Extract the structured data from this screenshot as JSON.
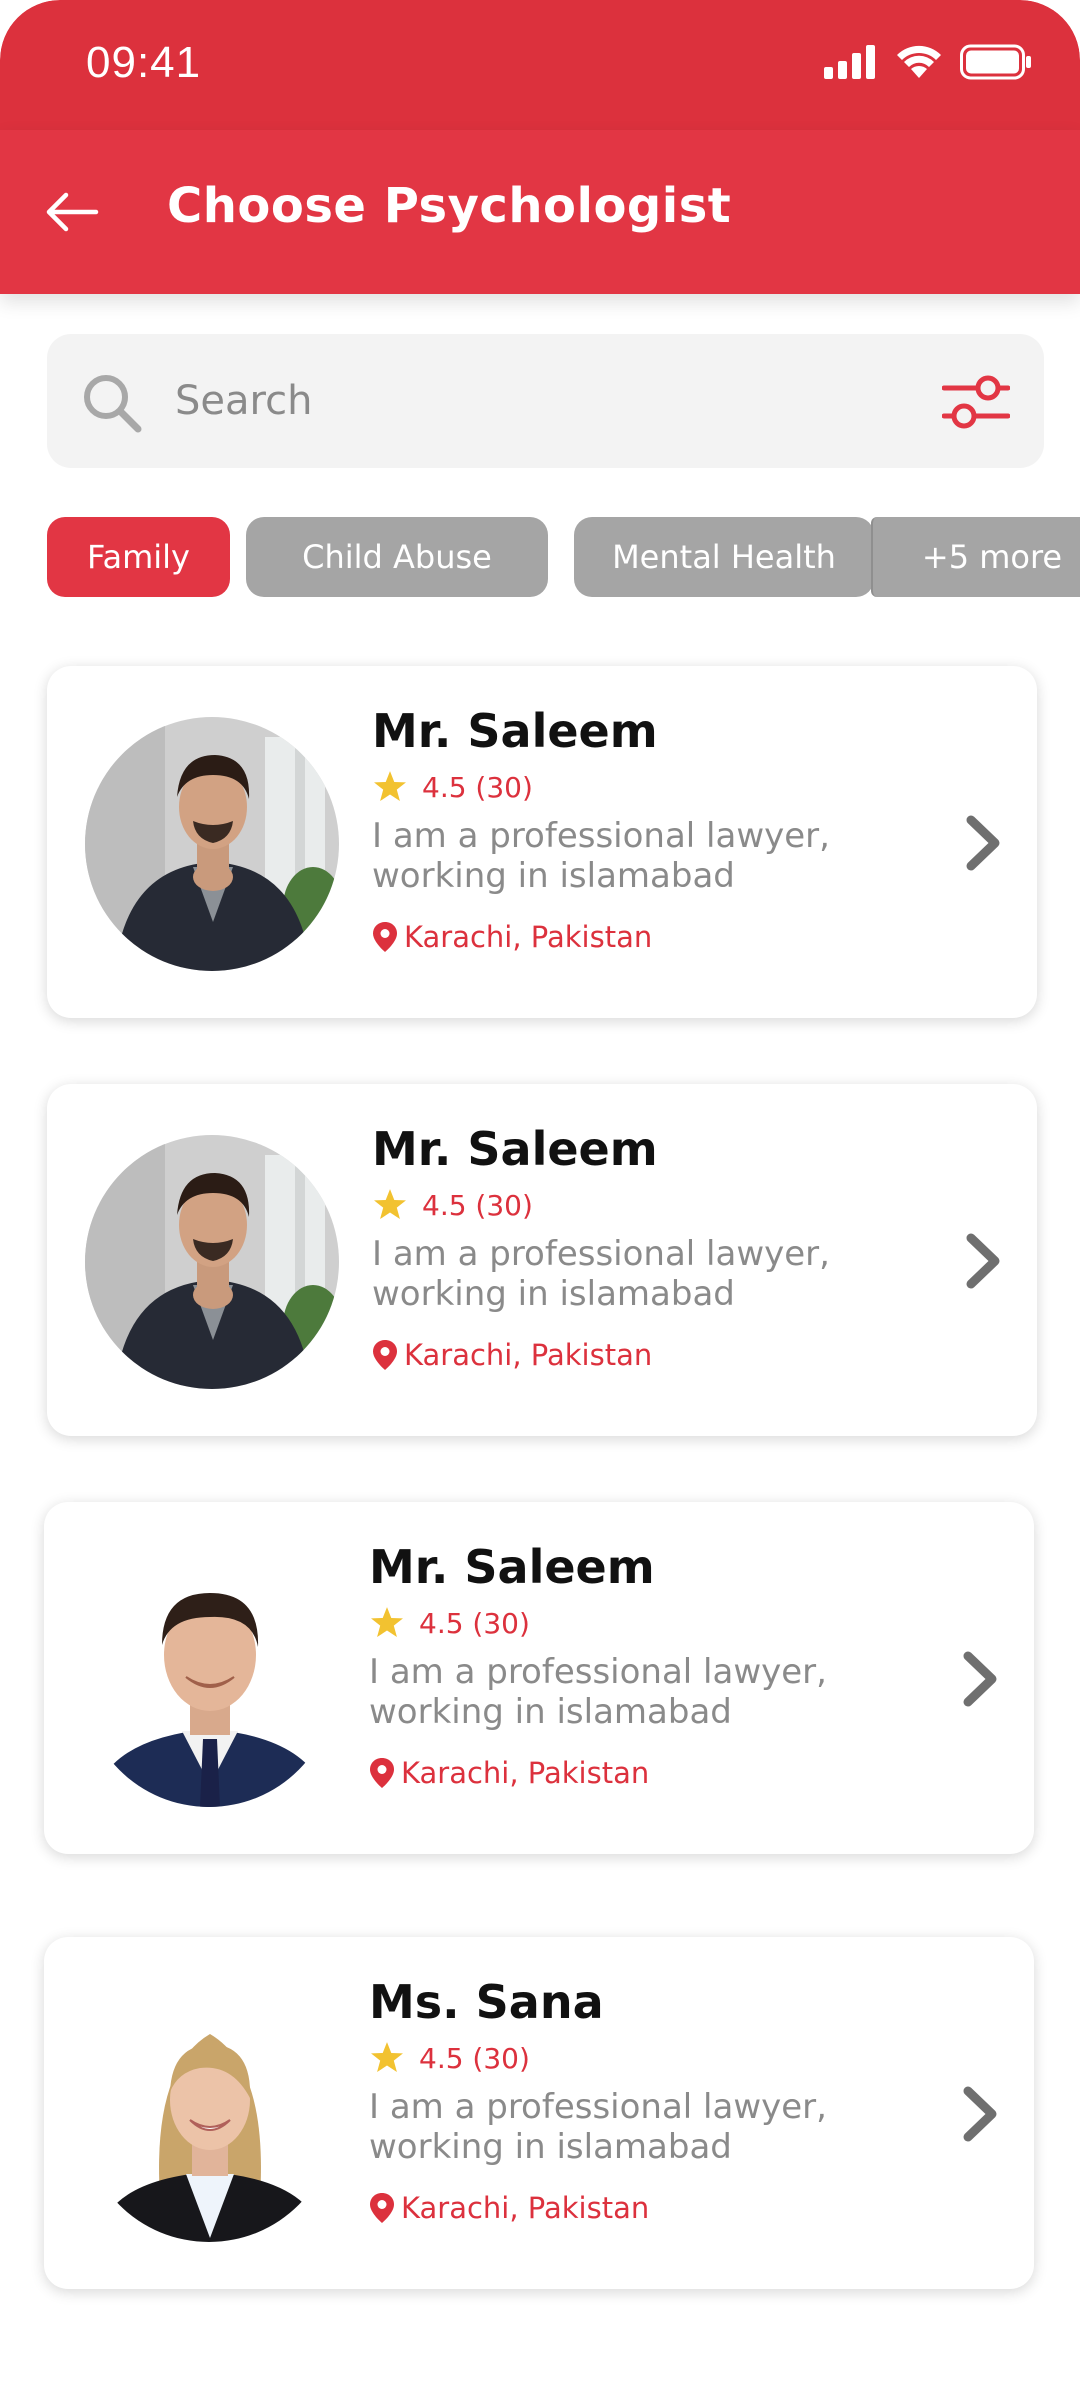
{
  "status_bar": {
    "time": "09:41"
  },
  "header": {
    "title": "Choose Psychologist"
  },
  "search": {
    "placeholder": "Search"
  },
  "chips": [
    {
      "label": "Family",
      "active": true
    },
    {
      "label": "Child Abuse",
      "active": false
    },
    {
      "label": "Mental Health",
      "active": false
    },
    {
      "label": "+5 more",
      "active": false
    }
  ],
  "psychologists": [
    {
      "name": "Mr. Saleem",
      "rating": "4.5 (30)",
      "description": "I am a professional lawyer, working in islamabad",
      "location": "Karachi, Pakistan"
    },
    {
      "name": "Mr. Saleem",
      "rating": "4.5 (30)",
      "description": "I am a professional lawyer, working in islamabad",
      "location": "Karachi, Pakistan"
    },
    {
      "name": "Mr. Saleem",
      "rating": "4.5 (30)",
      "description": "I am a professional lawyer, working in islamabad",
      "location": "Karachi, Pakistan"
    },
    {
      "name": "Ms. Sana",
      "rating": "4.5 (30)",
      "description": "I am a professional lawyer, working in islamabad",
      "location": "Karachi, Pakistan"
    }
  ],
  "colors": {
    "primary": "#e23644",
    "star": "#f2c230",
    "chip_inactive": "#a5a5a5"
  }
}
